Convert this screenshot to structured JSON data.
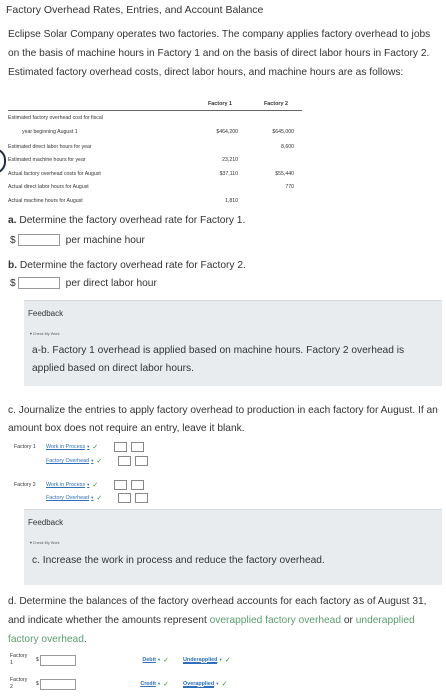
{
  "title": "Factory Overhead Rates, Entries, and Account Balance",
  "intro": "Eclipse Solar Company operates two factories. The company applies factory overhead to jobs on the basis of machine hours in Factory 1 and on the basis of direct labor hours in Factory 2. Estimated factory overhead costs, direct labor hours, and machine hours are as follows:",
  "table": {
    "col1": "Factory 1",
    "col2": "Factory 2",
    "rows": [
      {
        "label": "Estimated factory overhead cost for fiscal",
        "v1": "",
        "v2": ""
      },
      {
        "label": "year beginning August 1",
        "v1": "$464,200",
        "v2": "$645,000"
      },
      {
        "label": "Estimated direct labor hours for year",
        "v1": "",
        "v2": "8,600"
      },
      {
        "label": "Estimated machine hours for year",
        "v1": "23,210",
        "v2": ""
      },
      {
        "label": "Actual factory overhead costs for August",
        "v1": "$37,110",
        "v2": "$55,440"
      },
      {
        "label": "Actual direct labor hours for August",
        "v1": "",
        "v2": "770"
      },
      {
        "label": "Actual machine hours for August",
        "v1": "1,810",
        "v2": ""
      }
    ]
  },
  "qa": {
    "label": "a.",
    "text": "Determine the factory overhead rate for Factory 1.",
    "dollar": "$",
    "unit": "per machine hour"
  },
  "qb": {
    "label": "b.",
    "text": "Determine the factory overhead rate for Factory 2.",
    "dollar": "$",
    "unit": "per direct labor hour"
  },
  "feedback1": {
    "title": "Feedback",
    "check": "▼Check My Work",
    "text": "a-b. Factory 1 overhead is applied based on machine hours. Factory 2 overhead is applied based on direct labor hours."
  },
  "qc": {
    "text": "c. Journalize the entries to apply factory overhead to production in each factory for August. If an amount box does not require an entry, leave it blank.",
    "f1_label": "Factory 1",
    "f1_debit": "Work in Process",
    "f1_credit": "Factory Overhead",
    "f2_label": "Factory 2",
    "f2_debit": "Work in Process",
    "f2_credit": "Factory Overhead"
  },
  "feedback2": {
    "title": "Feedback",
    "check": "▼Check My Work",
    "text": "c. Increase the work in process and reduce the factory overhead."
  },
  "qd": {
    "text_a": "d. Determine the balances of the factory overhead accounts for each factory as of August 31, and indicate whether the amounts represent ",
    "green1": "overapplied factory overhead",
    "mid": " or ",
    "green2": "underapplied factory overhead",
    "end": ".",
    "row1_label_a": "Factory",
    "row1_label_b": "1",
    "row1_bal": "Debit",
    "row1_status": "Underapplied",
    "row2_label_a": "Factory",
    "row2_label_b": "2",
    "row2_bal": "Credit",
    "row2_status": "Overapplied",
    "dollar": "$"
  },
  "marks": {
    "check": "✓",
    "caret": "▾"
  }
}
